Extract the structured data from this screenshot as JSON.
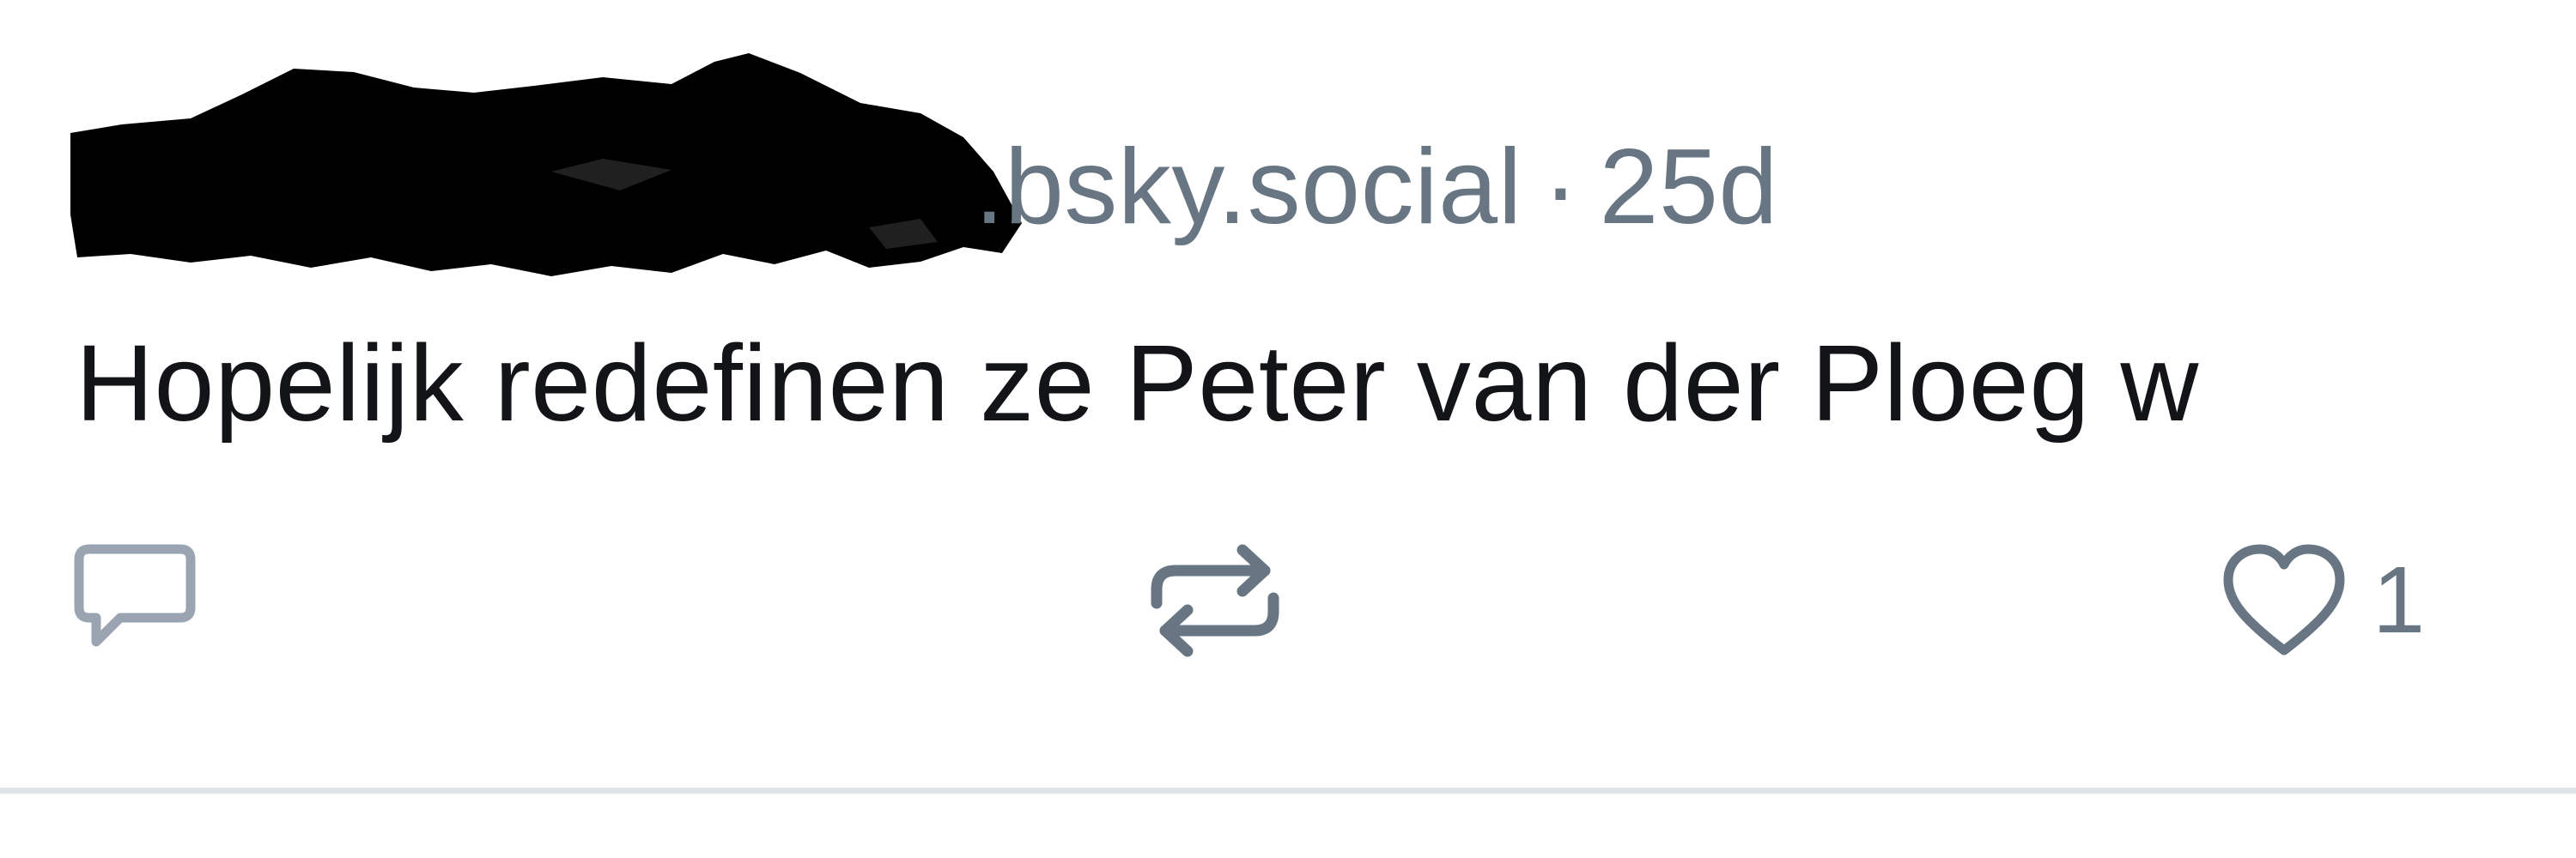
{
  "post": {
    "handle_visible": ".bsky.social",
    "separator": "·",
    "age": "25d",
    "text": "Hopelijk redefinen ze Peter van der Ploeg w",
    "actions": {
      "reply_icon": "speech-bubble-icon",
      "repost_icon": "repost-arrows-icon",
      "like_icon": "heart-icon",
      "like_count": "1"
    }
  },
  "colors": {
    "text_primary": "#121417",
    "text_muted": "#687684",
    "divider": "#dfe3e8",
    "redaction": "#000000"
  }
}
